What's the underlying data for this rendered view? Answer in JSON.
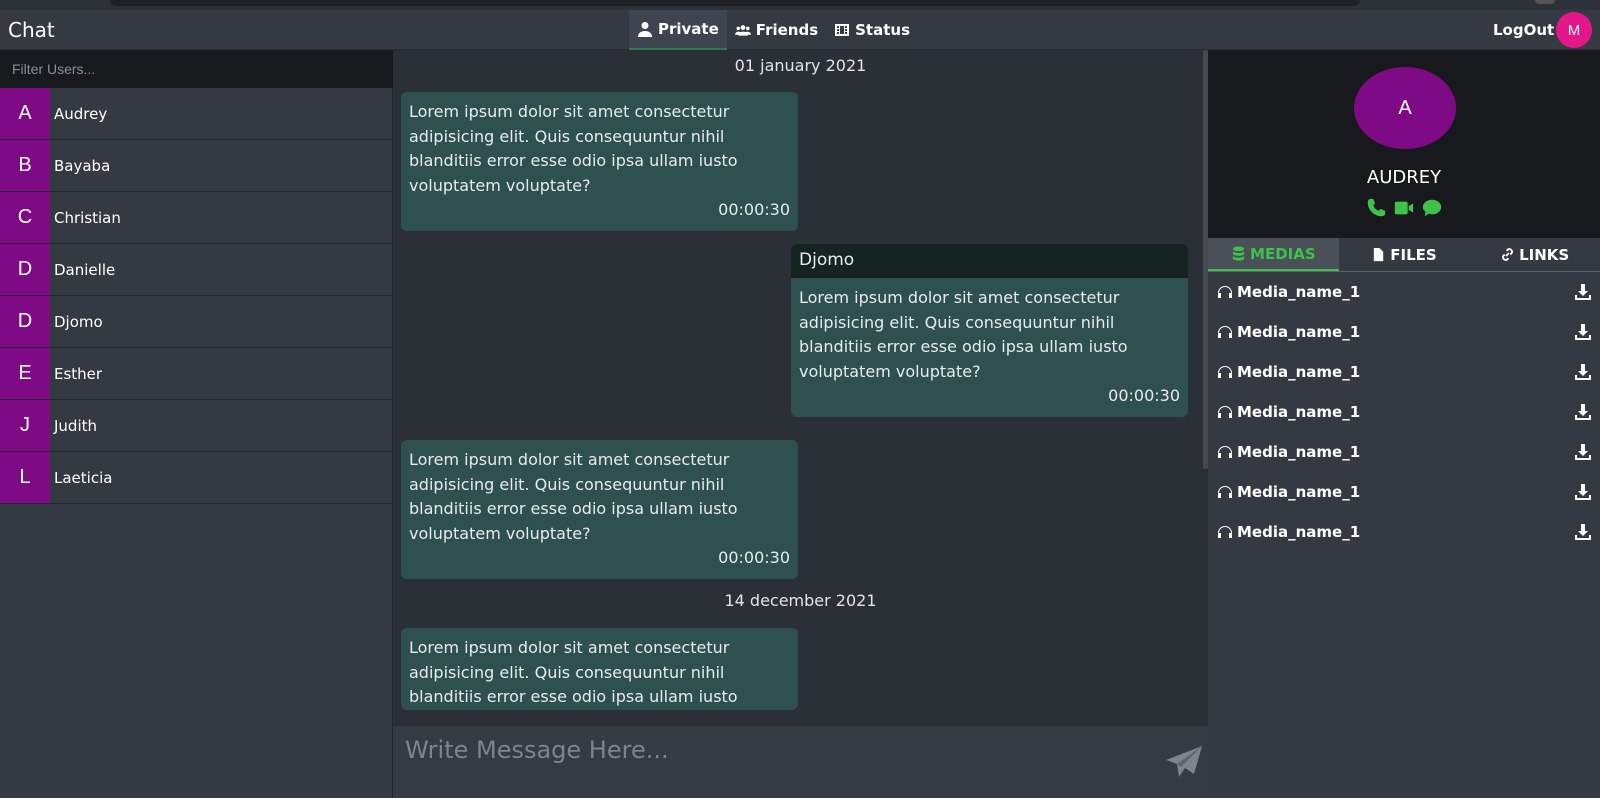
{
  "app": {
    "title": "Chat",
    "logout_label": "LogOut",
    "user_initial": "M"
  },
  "nav": {
    "tabs": [
      {
        "label": "Private",
        "icon": "user-icon",
        "active": true
      },
      {
        "label": "Friends",
        "icon": "users-icon"
      },
      {
        "label": "Status",
        "icon": "film-icon"
      }
    ]
  },
  "sidebar": {
    "filter_placeholder": "Filter Users...",
    "users": [
      {
        "initial": "A",
        "name": "Audrey"
      },
      {
        "initial": "B",
        "name": "Bayaba"
      },
      {
        "initial": "C",
        "name": "Christian"
      },
      {
        "initial": "D",
        "name": "Danielle"
      },
      {
        "initial": "D",
        "name": "Djomo"
      },
      {
        "initial": "E",
        "name": "Esther"
      },
      {
        "initial": "J",
        "name": "Judith"
      },
      {
        "initial": "L",
        "name": "Laeticia"
      }
    ]
  },
  "chat": {
    "dates": [
      "01 january 2021",
      "14 december 2021"
    ],
    "messages": [
      {
        "text": "Lorem ipsum dolor sit amet consectetur adipisicing elit. Quis consequuntur nihil blanditiis error esse odio ipsa ullam iusto voluptatem voluptate?",
        "time": "00:00:30"
      },
      {
        "sender": "Djomo",
        "text": "Lorem ipsum dolor sit amet consectetur adipisicing elit. Quis consequuntur nihil blanditiis error esse odio ipsa ullam iusto voluptatem voluptate?",
        "time": "00:00:30"
      },
      {
        "text": "Lorem ipsum dolor sit amet consectetur adipisicing elit. Quis consequuntur nihil blanditiis error esse odio ipsa ullam iusto voluptatem voluptate?",
        "time": "00:00:30"
      },
      {
        "text": "Lorem ipsum dolor sit amet consectetur adipisicing elit. Quis consequuntur nihil blanditiis error esse odio ipsa ullam iusto",
        "time": ""
      }
    ],
    "composer_placeholder": "Write Message Here..."
  },
  "profile": {
    "initial": "A",
    "name": "AUDREY",
    "actions": [
      "phone-icon",
      "video-icon",
      "comment-icon"
    ],
    "tabs": [
      {
        "label": "MEDIAS",
        "icon": "database-icon",
        "active": true
      },
      {
        "label": "FILES",
        "icon": "file-icon"
      },
      {
        "label": "LINKS",
        "icon": "link-icon"
      }
    ],
    "media": [
      {
        "name": "Media_name_1"
      },
      {
        "name": "Media_name_1"
      },
      {
        "name": "Media_name_1"
      },
      {
        "name": "Media_name_1"
      },
      {
        "name": "Media_name_1"
      },
      {
        "name": "Media_name_1"
      },
      {
        "name": "Media_name_1"
      }
    ]
  },
  "colors": {
    "accent": "#3ec24b",
    "avatar": "#7f0a86",
    "user_avatar": "#e4168a",
    "bubble": "#2e504f"
  }
}
